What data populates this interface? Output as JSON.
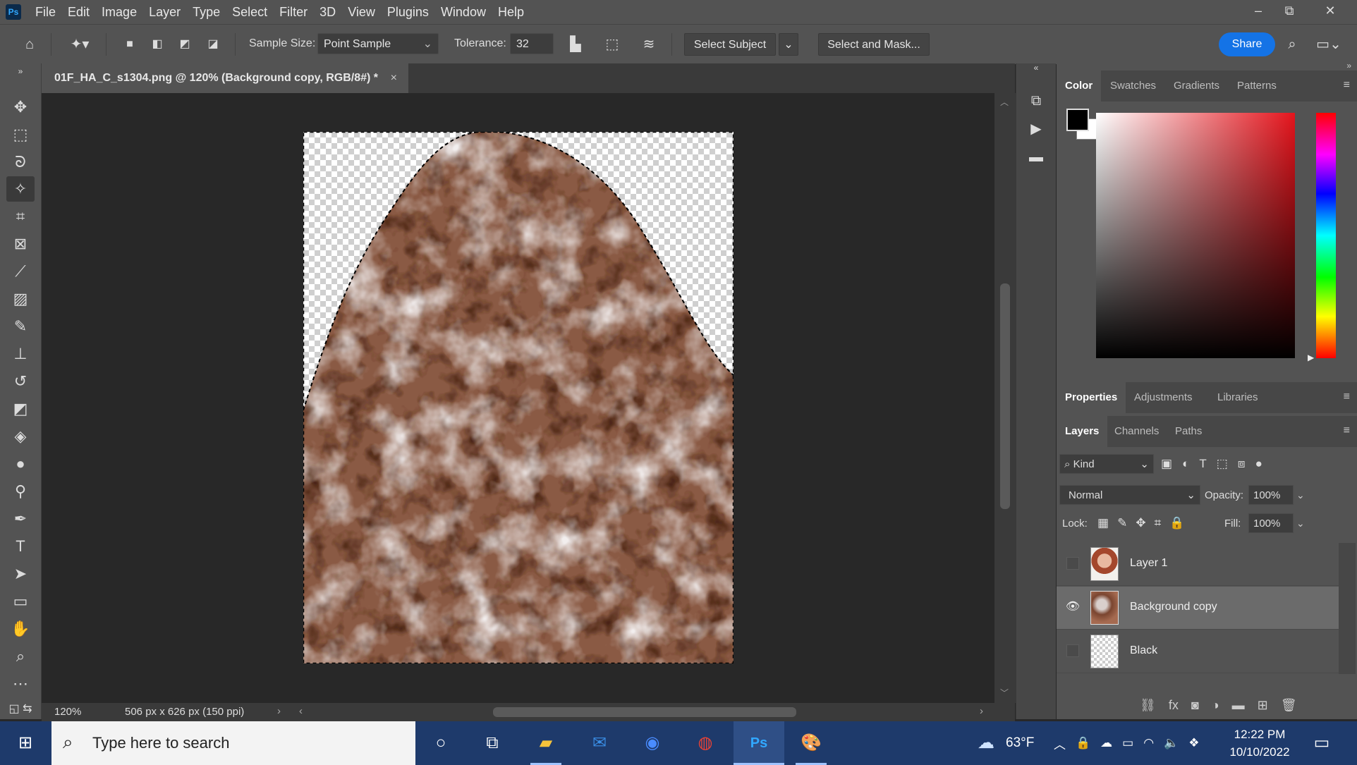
{
  "app": {
    "logo": "Ps"
  },
  "menu": [
    "File",
    "Edit",
    "Image",
    "Layer",
    "Type",
    "Select",
    "Filter",
    "3D",
    "View",
    "Plugins",
    "Window",
    "Help"
  ],
  "window_controls": {
    "minimize": "–",
    "restore": "⧉",
    "close": "✕"
  },
  "options": {
    "sample_size_label": "Sample Size:",
    "sample_size_value": "Point Sample",
    "tolerance_label": "Tolerance:",
    "tolerance_value": "32",
    "select_subject": "Select Subject",
    "select_and_mask": "Select and Mask...",
    "share": "Share"
  },
  "document": {
    "tab_title": "01F_HA_C_s1304.png @ 120% (Background copy, RGB/8#) *",
    "close": "×",
    "zoom": "120%",
    "doc_info": "506 px x 626 px (150 ppi)"
  },
  "color_panel": {
    "tabs": [
      "Color",
      "Swatches",
      "Gradients",
      "Patterns"
    ]
  },
  "properties_panel": {
    "tabs": [
      "Properties",
      "Adjustments",
      "Libraries"
    ]
  },
  "layers_panel": {
    "tabs": [
      "Layers",
      "Channels",
      "Paths"
    ],
    "filter_kind": "Kind",
    "blend_mode": "Normal",
    "opacity_label": "Opacity:",
    "opacity_value": "100%",
    "lock_label": "Lock:",
    "fill_label": "Fill:",
    "fill_value": "100%",
    "layers": [
      {
        "name": "Layer 1",
        "visible": false,
        "selected": false
      },
      {
        "name": "Background copy",
        "visible": true,
        "selected": true
      },
      {
        "name": "Black",
        "visible": false,
        "selected": false
      }
    ]
  },
  "taskbar": {
    "search_placeholder": "Type here to search",
    "weather": "63°F",
    "time": "12:22 PM",
    "date": "10/10/2022"
  },
  "colors": {
    "accent": "#1473e6",
    "panel": "#535353",
    "canvas": "#282828"
  }
}
